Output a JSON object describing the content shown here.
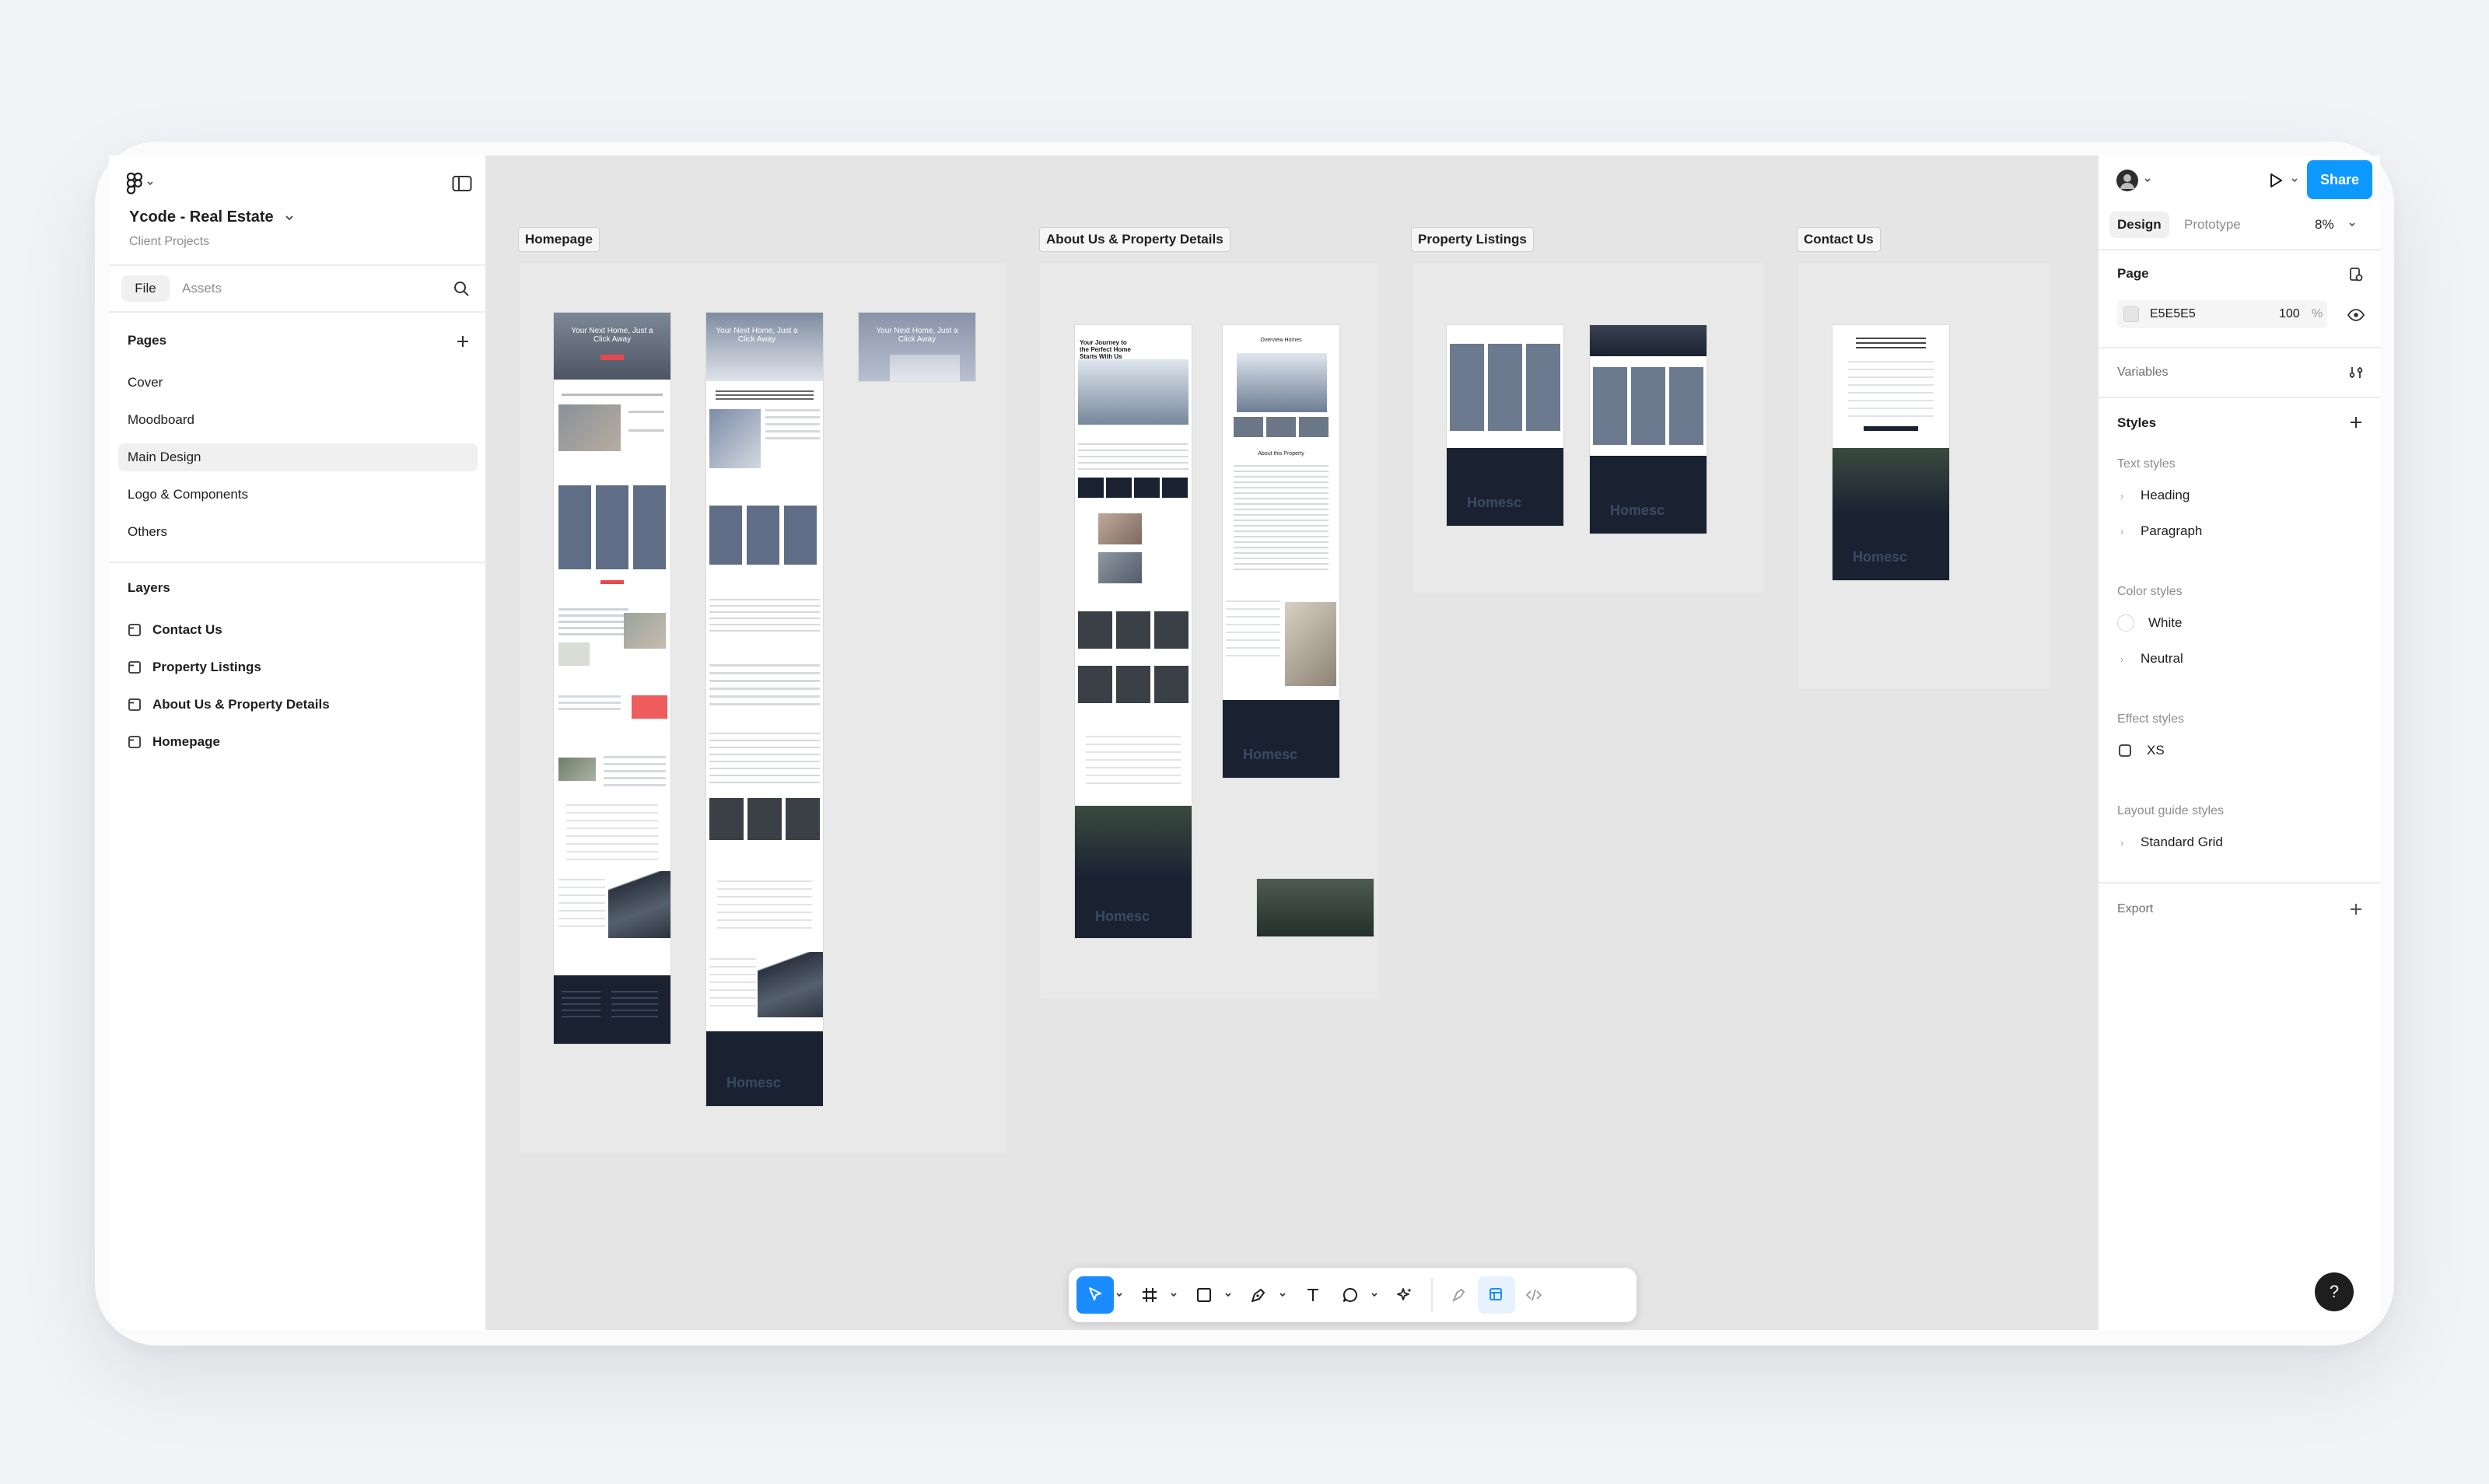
{
  "app": {
    "project_title": "Ycode - Real Estate",
    "project_subtitle": "Client Projects"
  },
  "sidebar": {
    "tabs": {
      "file": "File",
      "assets": "Assets"
    },
    "pages_title": "Pages",
    "pages": [
      "Cover",
      "Moodboard",
      "Main Design",
      "Logo & Components",
      "Others"
    ],
    "selected_page": "Main Design",
    "layers_title": "Layers",
    "layers": [
      "Contact Us",
      "Property Listings",
      "About Us & Property Details",
      "Homepage"
    ]
  },
  "canvas": {
    "background": "#E5E5E5",
    "sections": [
      {
        "label": "Homepage"
      },
      {
        "label": "About Us & Property Details"
      },
      {
        "label": "Property Listings"
      },
      {
        "label": "Contact Us"
      }
    ],
    "mockup_texts": {
      "hero_heading": "Your Next Home, Just a Click Away",
      "about_heading": "Your Journey to the Perfect Home Starts With Us",
      "overview_heading": "Overview Homes",
      "about_property": "About this Property",
      "brand": "Homesc"
    }
  },
  "toolbar": {
    "tools": [
      "move-tool",
      "frame-tool",
      "shape-tool",
      "pen-tool",
      "text-tool",
      "comment-tool",
      "actions-tool",
      "draw-mode",
      "design-mode",
      "dev-mode"
    ]
  },
  "right_panel": {
    "tabs": {
      "design": "Design",
      "prototype": "Prototype"
    },
    "zoom": "8%",
    "share_label": "Share",
    "page_section": "Page",
    "page_color": "E5E5E5",
    "page_opacity": "100",
    "page_opacity_unit": "%",
    "variables": "Variables",
    "styles": "Styles",
    "text_styles_title": "Text styles",
    "text_styles": [
      "Heading",
      "Paragraph"
    ],
    "color_styles_title": "Color styles",
    "color_styles": [
      {
        "name": "White",
        "color": "#FFFFFF"
      },
      {
        "name": "Neutral",
        "color": "#F5F5F5"
      }
    ],
    "effect_styles_title": "Effect styles",
    "effect_styles": [
      "XS"
    ],
    "layout_guide_title": "Layout guide styles",
    "layout_guides": [
      "Standard Grid"
    ],
    "export": "Export",
    "help": "?"
  },
  "colors": {
    "accent": "#0D99FF",
    "tool_active": "#1A8CFF",
    "dark_footer": "#1A2232",
    "cta_red": "#E5484D"
  }
}
